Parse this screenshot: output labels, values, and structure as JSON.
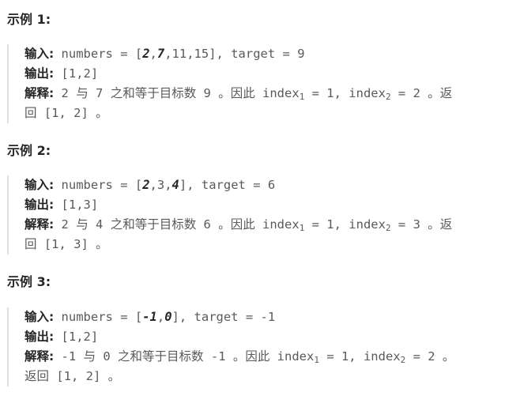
{
  "labels": {
    "input": "输入:",
    "output": "输出:",
    "explanation": "解释:"
  },
  "examples": [
    {
      "title": "示例 1:",
      "input": {
        "pre": " numbers = [",
        "b1": "2",
        "sep1": ",",
        "b2": "7",
        "rest": ",11,15], target = 9"
      },
      "output": " [1,2]",
      "explanation": {
        "a": " 2 与 7 之和等于目标数 9 。因此 index",
        "sub1": "1",
        "b": " = 1, index",
        "sub2": "2",
        "c": " = 2 。返",
        "line2": "回 [1, 2] 。"
      }
    },
    {
      "title": "示例 2:",
      "input": {
        "pre": " numbers = [",
        "b1": "2",
        "sep1": ",3,",
        "b2": "4",
        "rest": "], target = 6"
      },
      "output": " [1,3]",
      "explanation": {
        "a": " 2 与 4 之和等于目标数 6 。因此 index",
        "sub1": "1",
        "b": " = 1, index",
        "sub2": "2",
        "c": " = 3 。返",
        "line2": "回 [1, 3] 。"
      }
    },
    {
      "title": "示例 3:",
      "input": {
        "pre": " numbers = [",
        "b1": "-1",
        "sep1": ",",
        "b2": "0",
        "rest": "], target = -1"
      },
      "output": " [1,2]",
      "explanation": {
        "a": " -1 与 0 之和等于目标数 -1 。因此 index",
        "sub1": "1",
        "b": " = 1, index",
        "sub2": "2",
        "c": " = 2 。",
        "line2": "返回 [1, 2] 。"
      }
    }
  ]
}
